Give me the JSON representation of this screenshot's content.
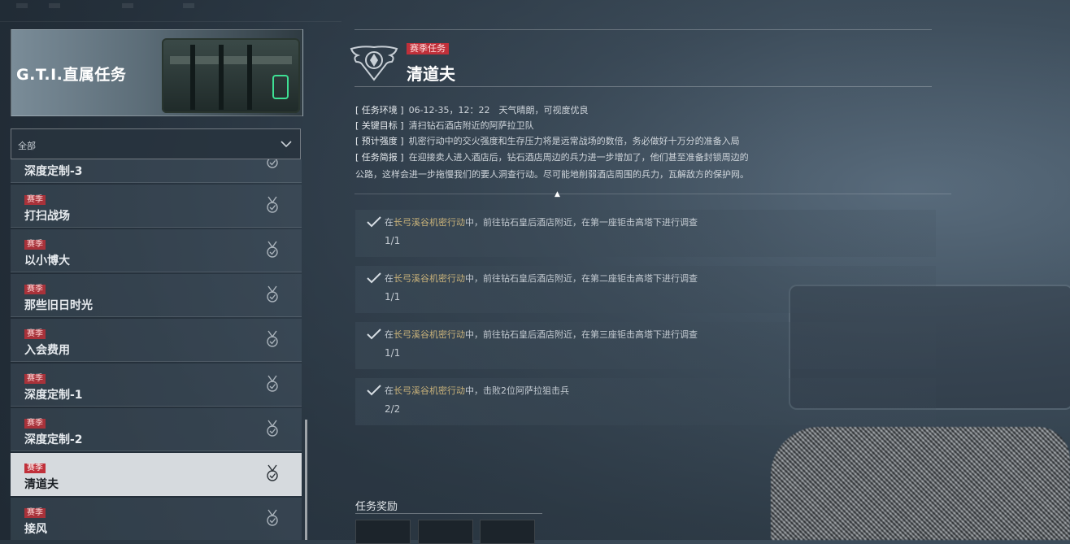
{
  "left": {
    "banner_title": "G.T.I.直属任务",
    "filter": {
      "selected": "全部"
    },
    "missions": [
      {
        "tag": "",
        "name": "深度定制-3",
        "active": false
      },
      {
        "tag": "赛季",
        "name": "打扫战场",
        "active": false
      },
      {
        "tag": "赛季",
        "name": "以小博大",
        "active": false
      },
      {
        "tag": "赛季",
        "name": "那些旧日时光",
        "active": false
      },
      {
        "tag": "赛季",
        "name": "入会费用",
        "active": false
      },
      {
        "tag": "赛季",
        "name": "深度定制-1",
        "active": false
      },
      {
        "tag": "赛季",
        "name": "深度定制-2",
        "active": false
      },
      {
        "tag": "赛季",
        "name": "清道夫",
        "active": true
      },
      {
        "tag": "赛季",
        "name": "接风",
        "active": false
      }
    ]
  },
  "mission": {
    "type_tag": "赛季任务",
    "title": "清道夫",
    "info": [
      {
        "key": "[ 任务环境 ]",
        "value": "06-12-35，12：22　天气晴朗，可视度优良"
      },
      {
        "key": "[ 关键目标 ]",
        "value": "清扫钻石酒店附近的阿萨拉卫队"
      },
      {
        "key": "[ 预计强度 ]",
        "value": "机密行动中的交火强度和生存压力将是远常战场的数倍，务必做好十万分的准备入局"
      },
      {
        "key": "[ 任务简报 ]",
        "value": "在迎接卖人进入酒店后，钻石酒店周边的兵力进一步增加了，他们甚至准备封锁周边的"
      }
    ],
    "info_cont": "公路，这样会进一步拖慢我们的要人洞查行动。尽可能地削弱酒店周围的兵力，瓦解敌方的保护网。",
    "objectives": [
      {
        "prefix": "在",
        "highlight": "长弓溪谷机密行动",
        "text": "中，前往钻石皇后酒店附近，在第一座钜击高塔下进行调查",
        "count": "1/1"
      },
      {
        "prefix": "在",
        "highlight": "长弓溪谷机密行动",
        "text": "中，前往钻石皇后酒店附近，在第二座钜击高塔下进行调查",
        "count": "1/1"
      },
      {
        "prefix": "在",
        "highlight": "长弓溪谷机密行动",
        "text": "中，前往钻石皇后酒店附近，在第三座钜击高塔下进行调查",
        "count": "1/1"
      },
      {
        "prefix": "在",
        "highlight": "长弓溪谷机密行动",
        "text": "中，击败2位阿萨拉狙击兵",
        "count": "2/2"
      }
    ],
    "rewards_label": "任务奖励"
  },
  "colors": {
    "accent_red": "#c0303a",
    "highlight_gold": "#c9b27a",
    "selected_bg": "#d6dade"
  },
  "icons": {
    "emblem": "eagle-emblem-icon",
    "medal": "medal-icon",
    "check": "check-icon",
    "chevron": "chevron-down-icon"
  }
}
